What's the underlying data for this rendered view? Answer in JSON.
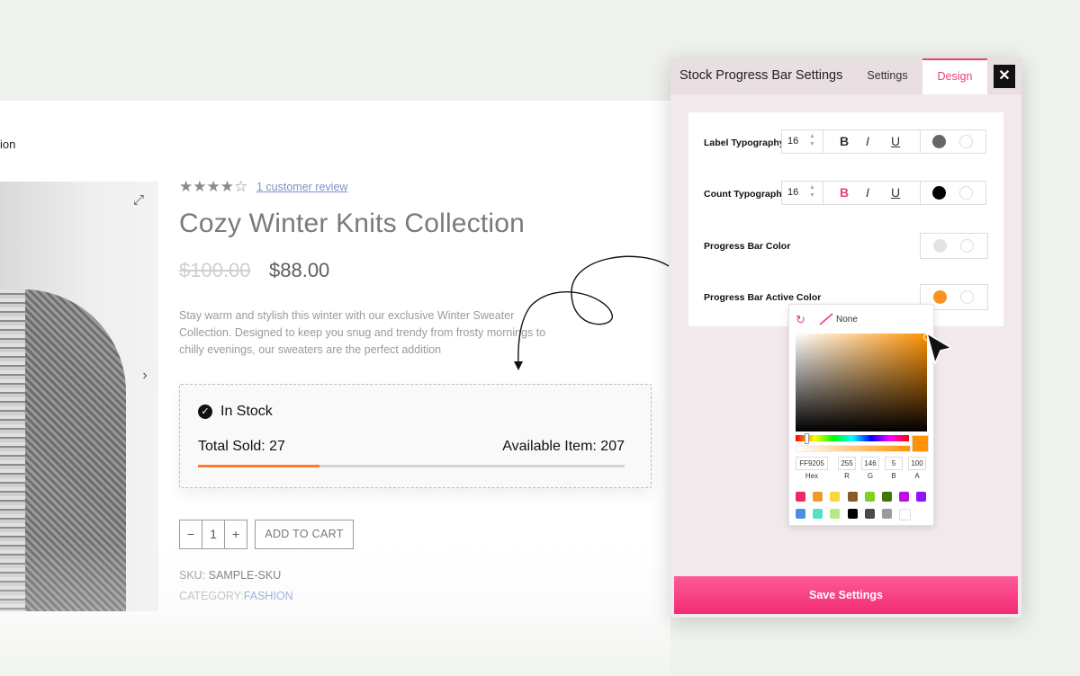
{
  "nav": {
    "fragment": "ion"
  },
  "product": {
    "review_link": "1 customer review",
    "rating": 4,
    "rating_max": 5,
    "title": "Cozy Winter Knits Collection",
    "price_old": "$100.00",
    "price_new": "$88.00",
    "description": "Stay warm and stylish this winter with our exclusive Winter Sweater Collection. Designed to keep you snug and trendy from frosty mornings to chilly evenings, our sweaters are the perfect addition",
    "stock_status": "In Stock",
    "total_sold": "Total Sold: 27",
    "available": "Available Item: 207",
    "sold_fraction": 0.285,
    "qty_minus": "−",
    "qty_value": "1",
    "qty_plus": "+",
    "add_to_cart": "ADD TO CART",
    "sku_label": "SKU:",
    "sku_value": "SAMPLE-SKU",
    "category_label": "CATEGORY:",
    "category_value": "FASHION"
  },
  "panel": {
    "title": "Stock Progress Bar Settings",
    "tab_settings": "Settings",
    "tab_design": "Design",
    "close": "✕",
    "rows": {
      "label_typography": {
        "label": "Label Typography",
        "size": "16",
        "color": "#666666"
      },
      "count_typography": {
        "label": "Count Typography",
        "size": "16",
        "color": "#000000"
      },
      "progress_bar_color": {
        "label": "Progress Bar Color",
        "color": "#e3e3e3"
      },
      "progress_bar_active_color": {
        "label": "Progress Bar Active Color",
        "color": "#f7931e"
      }
    },
    "bold": "B",
    "italic": "I",
    "underline": "U",
    "save_button": "Save Settings"
  },
  "picker": {
    "none_label": "None",
    "hex_value": "FF9205",
    "r_value": "255",
    "g_value": "146",
    "b_value": "5",
    "a_value": "100",
    "hex_label": "Hex",
    "r_label": "R",
    "g_label": "G",
    "b_label": "B",
    "a_label": "A",
    "presets": [
      "#ef2a63",
      "#ef9a2a",
      "#f7d83a",
      "#8b5a2b",
      "#7ed321",
      "#417505",
      "#bd10e0",
      "#9013fe",
      "#4a90e2",
      "#50e3c2",
      "#b8e986",
      "#000000",
      "#4a4a4a",
      "#9b9b9b",
      "#ffffff"
    ]
  }
}
